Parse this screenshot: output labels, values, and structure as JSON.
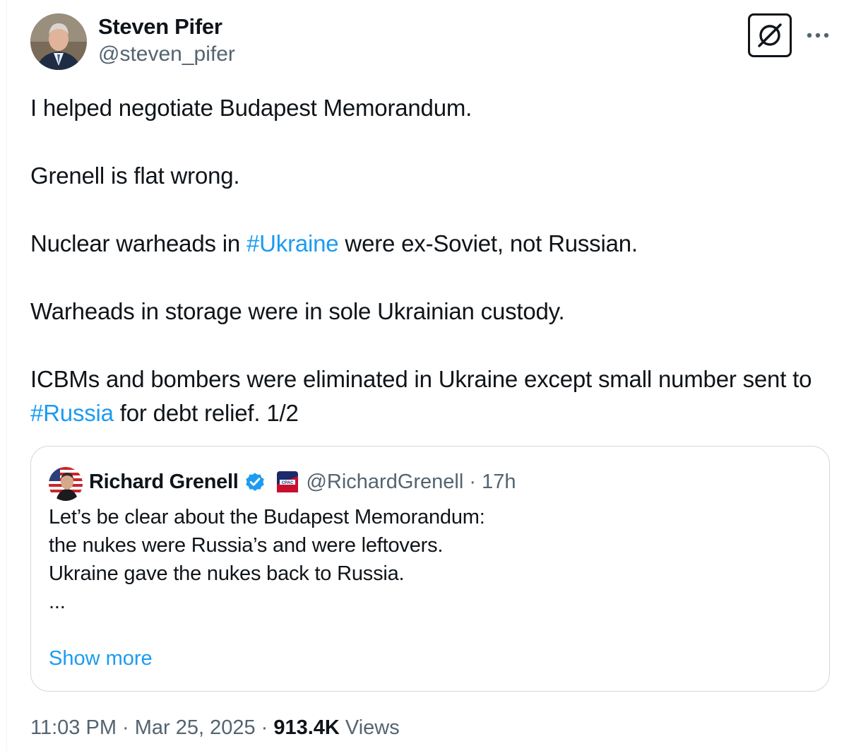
{
  "author": {
    "display_name": "Steven Pifer",
    "handle": "@steven_pifer"
  },
  "actions": {
    "grok_icon": "grok-icon",
    "more_icon": "more-dots-icon"
  },
  "tweet": {
    "p1": "I helped negotiate Budapest Memorandum.",
    "p2": "Grenell is flat wrong.",
    "p3_before": "Nuclear warheads in ",
    "p3_hashtag": "#Ukraine",
    "p3_after": " were ex-Soviet, not Russian.",
    "p4": "Warheads in storage were in sole Ukrainian custody.",
    "p5_before": "ICBMs and bombers were eliminated in Ukraine except small number sent to ",
    "p5_hashtag": "#Russia",
    "p5_after": " for debt relief. 1/2"
  },
  "quote": {
    "display_name": "Richard Grenell",
    "verified_icon": "verified-badge-icon",
    "affiliation_icon": "cpac-affiliation-icon",
    "handle_time": "@RichardGrenell · 17h",
    "lines": [
      "Let’s be clear about the Budapest Memorandum:",
      "the nukes were Russia’s and were leftovers.",
      "",
      "Ukraine gave the nukes back to Russia.",
      "..."
    ],
    "show_more": "Show more"
  },
  "meta": {
    "timestamp": "11:03 PM · Mar 25, 2025",
    "separator": "·",
    "views_count": "913.4K",
    "views_label": "Views"
  },
  "colors": {
    "text": "#0f1419",
    "secondary": "#536471",
    "link": "#1d9bf0",
    "border": "#cfd9de"
  }
}
